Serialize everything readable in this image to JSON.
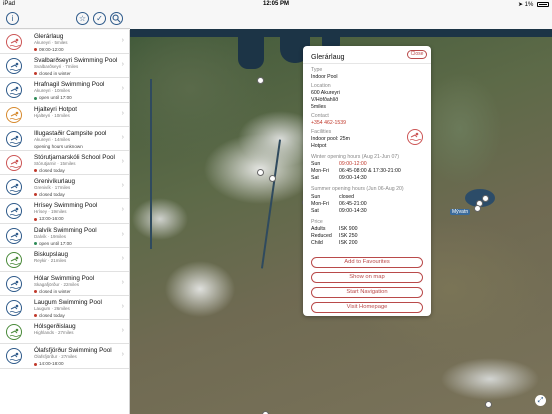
{
  "status_bar": {
    "device": "iPad",
    "time": "12:05 PM",
    "battery": "1%"
  },
  "toolbar": {
    "info_icon": "i",
    "favorites_icon": "☆",
    "check_icon": "✓",
    "search_icon": "🔍"
  },
  "pools": [
    {
      "name": "Glerárlaug",
      "sub": "Akureyri · 5miles",
      "status": "09:00-12:00",
      "dot": "#c0392b",
      "logo": "red"
    },
    {
      "name": "Svalbarðseyri Swimming Pool",
      "sub": "Svalbarðseyri · 7miles",
      "status": "closed in winter",
      "dot": "#c0392b",
      "logo": "blue"
    },
    {
      "name": "Hrafnagil Swimming Pool",
      "sub": "Akureyri · 10miles",
      "status": "open until 17:00",
      "dot": "#2e8b57",
      "logo": "blue"
    },
    {
      "name": "Hjalteyri Hotpot",
      "sub": "Hjalteyri · 10miles",
      "status": "",
      "dot": "",
      "logo": "orange"
    },
    {
      "name": "Illugastaðir Campsite pool",
      "sub": "Akureyri · 14miles",
      "status": "opening hours unknown",
      "dot": "",
      "logo": "blue"
    },
    {
      "name": "Stórutjarnarskóli School Pool",
      "sub": "Stórutjarnir · 15miles",
      "status": "closed today",
      "dot": "#c0392b",
      "logo": "red"
    },
    {
      "name": "Grenivíkurlaug",
      "sub": "Grenivík · 17miles",
      "status": "closed today",
      "dot": "#c0392b",
      "logo": "blue"
    },
    {
      "name": "Hrísey Swimming Pool",
      "sub": "Hrísey · 19miles",
      "status": "13:00-16:00",
      "dot": "#c0392b",
      "logo": "blue"
    },
    {
      "name": "Dalvík Swimming Pool",
      "sub": "Dalvík · 19miles",
      "status": "open until 17:00",
      "dot": "#2e8b57",
      "logo": "blue"
    },
    {
      "name": "Biskupslaug",
      "sub": "Reykir · 21miles",
      "status": "",
      "dot": "",
      "logo": "green"
    },
    {
      "name": "Hólar Swimming Pool",
      "sub": "Skagafjörður · 22miles",
      "status": "closed in winter",
      "dot": "#c0392b",
      "logo": "blue"
    },
    {
      "name": "Laugum Swimming Pool",
      "sub": "Laugum · 26miles",
      "status": "closed today",
      "dot": "#c0392b",
      "logo": "blue"
    },
    {
      "name": "Hólsgerðislaug",
      "sub": "Highlands · 27miles",
      "status": "",
      "dot": "",
      "logo": "green"
    },
    {
      "name": "Ólafsfjörður Swimming Pool",
      "sub": "Ólafsfjörður · 27miles",
      "status": "14:00-18:00",
      "dot": "#c0392b",
      "logo": "blue"
    }
  ],
  "map": {
    "place_label": "Mývatn"
  },
  "popup": {
    "title": "Glerárlaug",
    "close_label": "Close",
    "type_label": "Type",
    "type_value": "Indoor Pool",
    "location_label": "Location",
    "location_line1": "600 Akureyri",
    "location_line2": "V/Höfðahlíð",
    "location_line3": "5miles",
    "contact_label": "Contact",
    "contact_value": "+354 462-1539",
    "facilities_label": "Facilities",
    "facilities_line1": "Indoor pool: 25m",
    "facilities_line2": "Hotpot",
    "winter_label": "Winter opening hours (Aug 21-Jun 07)",
    "winter": [
      {
        "day": "Sun",
        "hours": "09:00-12:00",
        "highlight": true
      },
      {
        "day": "Mon-Fri",
        "hours": "06:45-08:00 & 17:30-21:00",
        "highlight": false
      },
      {
        "day": "Sat",
        "hours": "09:00-14:30",
        "highlight": false
      }
    ],
    "summer_label": "Summer opening hours (Jun 06-Aug 20)",
    "summer": [
      {
        "day": "Sun",
        "hours": "closed"
      },
      {
        "day": "Mon-Fri",
        "hours": "06:45-21:00"
      },
      {
        "day": "Sat",
        "hours": "09:00-14:30"
      }
    ],
    "price_label": "Price",
    "prices": [
      {
        "group": "Adults",
        "price": "ISK 900"
      },
      {
        "group": "Reduced",
        "price": "ISK 250"
      },
      {
        "group": "Child",
        "price": "ISK 200"
      }
    ],
    "buttons": {
      "favourites": "Add to Favourites",
      "show_map": "Show on map",
      "navigation": "Start Navigation",
      "homepage": "Visit Homepage"
    }
  }
}
